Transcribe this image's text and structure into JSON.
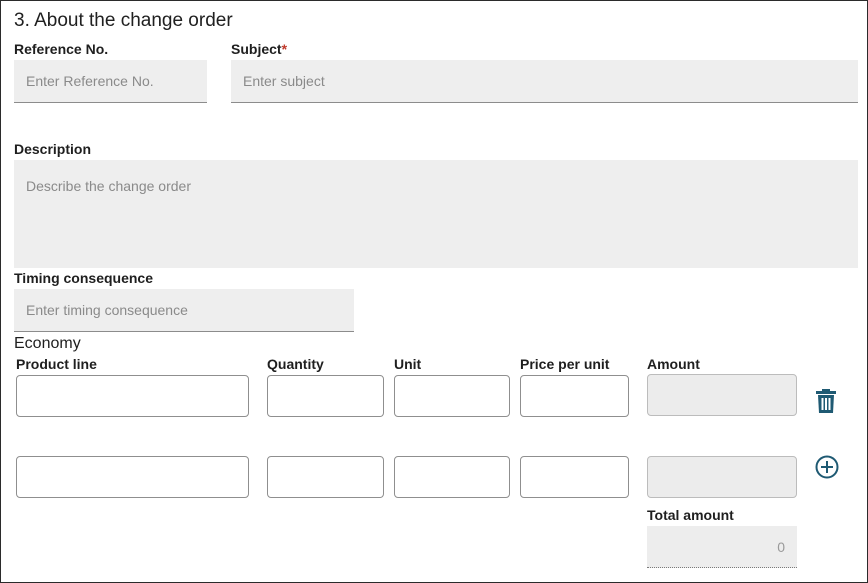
{
  "section": {
    "title": "3. About the change order"
  },
  "reference": {
    "label": "Reference No.",
    "placeholder": "Enter Reference No."
  },
  "subject": {
    "label": "Subject",
    "required_mark": "*",
    "placeholder": "Enter subject"
  },
  "description": {
    "label": "Description",
    "placeholder": "Describe the change order"
  },
  "timing": {
    "label": "Timing consequence",
    "placeholder": "Enter timing consequence"
  },
  "economy": {
    "title": "Economy",
    "columns": {
      "product_line": "Product line",
      "quantity": "Quantity",
      "unit": "Unit",
      "price_per_unit": "Price per unit",
      "amount": "Amount"
    },
    "total_label": "Total amount",
    "total_value": "0"
  },
  "icons": {
    "delete": "trash-icon",
    "add": "plus-circle-icon"
  },
  "colors": {
    "accent": "#1f5a73",
    "required": "#c0392b",
    "field_bg": "#eeeeee"
  }
}
